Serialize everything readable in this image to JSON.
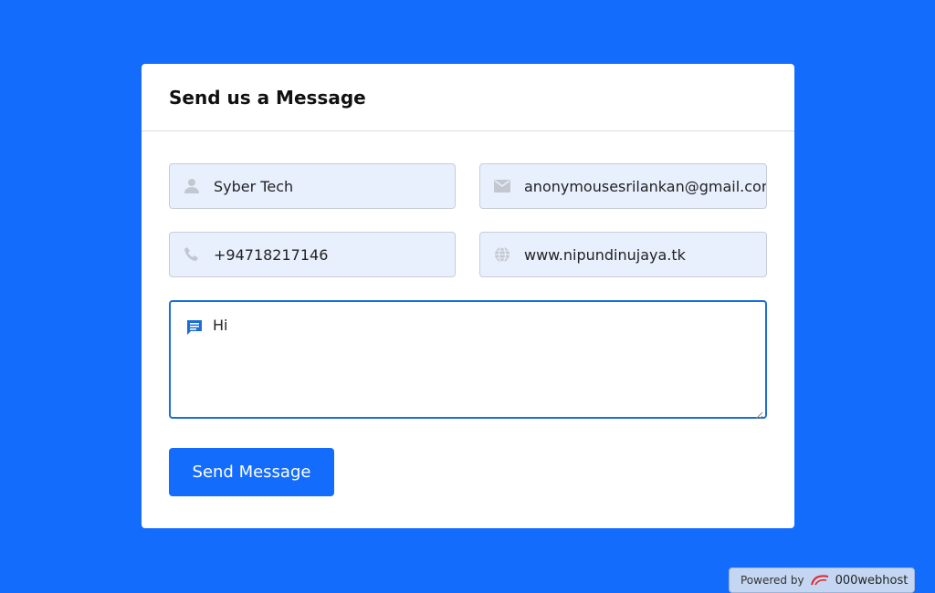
{
  "form": {
    "title": "Send us a Message",
    "name_value": "Syber Tech",
    "email_value": "anonymousesrilankan@gmail.com",
    "phone_value": "+94718217146",
    "website_value": "www.nipundinujaya.tk",
    "message_value": "Hi",
    "submit_label": "Send Message"
  },
  "footer": {
    "powered_label": "Powered by",
    "host_name": "000webhost"
  },
  "icons": {
    "name": "user-icon",
    "email": "envelope-icon",
    "phone": "phone-icon",
    "website": "globe-icon",
    "message": "message-icon"
  },
  "colors": {
    "background": "#136cfc",
    "accent": "#136cfc",
    "field_bg": "#e8f0fe",
    "focus_border": "#1a6ed6"
  }
}
